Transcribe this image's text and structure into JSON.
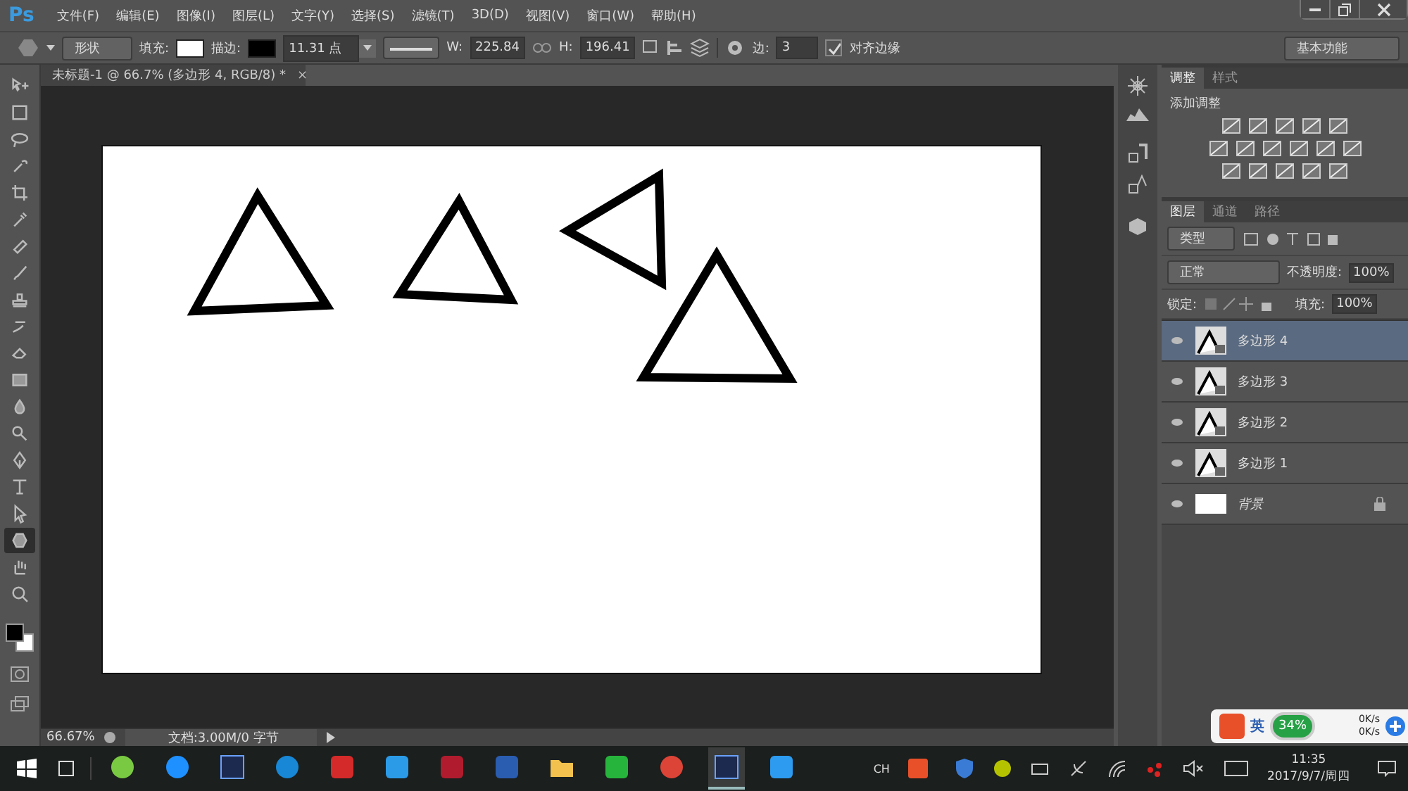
{
  "app": {
    "logo": "Ps"
  },
  "menu": [
    "文件(F)",
    "编辑(E)",
    "图像(I)",
    "图层(L)",
    "文字(Y)",
    "选择(S)",
    "滤镜(T)",
    "3D(D)",
    "视图(V)",
    "窗口(W)",
    "帮助(H)"
  ],
  "options_bar": {
    "mode": "形状",
    "fill_label": "填充:",
    "stroke_label": "描边:",
    "stroke_width": "11.31 点",
    "w_label": "W:",
    "w_value": "225.84",
    "h_label": "H:",
    "h_value": "196.41",
    "sides_label": "边:",
    "sides_value": "3",
    "align_edges": {
      "label": "对齐边缘",
      "checked": true
    },
    "workspace": "基本功能"
  },
  "document_tab": {
    "title": "未标题-1 @ 66.7% (多边形 4, RGB/8) *",
    "close": "×"
  },
  "tools": [
    {
      "kind": "move",
      "selected": false
    },
    {
      "kind": "marquee",
      "selected": false
    },
    {
      "kind": "lasso",
      "selected": false
    },
    {
      "kind": "quick",
      "selected": false
    },
    {
      "kind": "crop",
      "selected": false
    },
    {
      "kind": "dropper",
      "selected": false
    },
    {
      "kind": "heal",
      "selected": false
    },
    {
      "kind": "brush",
      "selected": false
    },
    {
      "kind": "stamp",
      "selected": false
    },
    {
      "kind": "history",
      "selected": false
    },
    {
      "kind": "eraser",
      "selected": false
    },
    {
      "kind": "gradient",
      "selected": false
    },
    {
      "kind": "blur",
      "selected": false
    },
    {
      "kind": "dodge",
      "selected": false
    },
    {
      "kind": "pen",
      "selected": false
    },
    {
      "kind": "type",
      "selected": false
    },
    {
      "kind": "select",
      "selected": false
    },
    {
      "kind": "shape",
      "selected": true
    },
    {
      "kind": "hand",
      "selected": false
    },
    {
      "kind": "zoom",
      "selected": false
    }
  ],
  "adjust_panel": {
    "tabs": [
      {
        "label": "调整",
        "selected": true
      },
      {
        "label": "样式",
        "selected": false
      }
    ],
    "heading": "添加调整"
  },
  "layers_panel": {
    "tabs": [
      {
        "label": "图层",
        "selected": true
      },
      {
        "label": "通道",
        "selected": false
      },
      {
        "label": "路径",
        "selected": false
      }
    ],
    "filter": "类型",
    "blend_mode": "正常",
    "opacity_label": "不透明度:",
    "opacity": "100%",
    "lock_label": "锁定:",
    "fill_label": "填充:",
    "fill": "100%",
    "layers": [
      {
        "name": "多边形 4",
        "kind": "shape",
        "selected": true,
        "visible": true,
        "locked": false
      },
      {
        "name": "多边形 3",
        "kind": "shape",
        "selected": false,
        "visible": true,
        "locked": false
      },
      {
        "name": "多边形 2",
        "kind": "shape",
        "selected": false,
        "visible": true,
        "locked": false
      },
      {
        "name": "多边形 1",
        "kind": "shape",
        "selected": false,
        "visible": true,
        "locked": false
      },
      {
        "name": "背景",
        "kind": "background",
        "selected": false,
        "visible": true,
        "locked": true
      }
    ]
  },
  "status_bar": {
    "zoom": "66.67%",
    "doc_info": "文档:3.00M/0 字节"
  },
  "taskbar": {
    "apps": [
      {
        "kind": "circle",
        "color": "#7ac943",
        "selected": false
      },
      {
        "kind": "ie",
        "color": "#1e90ff",
        "selected": false
      },
      {
        "kind": "ps",
        "color": "#1c2a4f",
        "selected": false
      },
      {
        "kind": "circle",
        "color": "#1787d6",
        "selected": false
      },
      {
        "kind": "square",
        "color": "#d42a2a",
        "selected": false
      },
      {
        "kind": "square",
        "color": "#2b9be8",
        "selected": false
      },
      {
        "kind": "square",
        "color": "#b01c2e",
        "selected": false
      },
      {
        "kind": "square",
        "color": "#2a5db0",
        "selected": false
      },
      {
        "kind": "folder",
        "color": "#f2c14e",
        "selected": false
      },
      {
        "kind": "square",
        "color": "#27b43c",
        "selected": false
      },
      {
        "kind": "chrome",
        "color": "#db4437",
        "selected": false
      },
      {
        "kind": "ps",
        "color": "#1c2a4f",
        "selected": true
      },
      {
        "kind": "square",
        "color": "#2d9bef",
        "selected": false
      }
    ],
    "ime": "CH",
    "time": "11:35",
    "date": "2017/9/7/周四"
  },
  "speed_widget": {
    "ime": "英",
    "percent": "34%",
    "up": "0K/s",
    "down": "0K/s"
  }
}
